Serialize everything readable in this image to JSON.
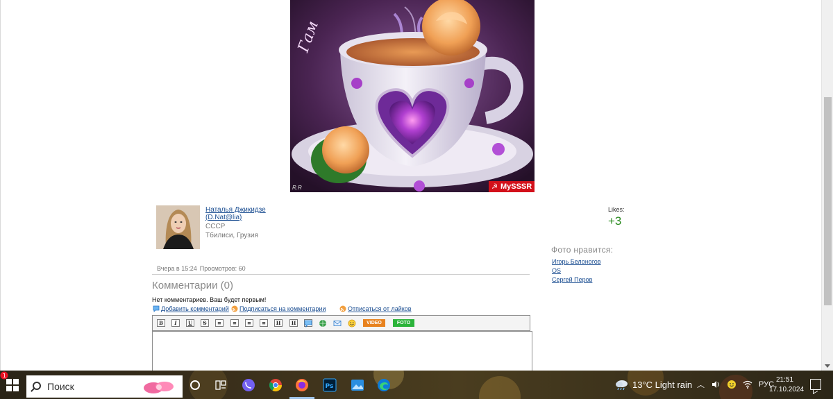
{
  "photo": {
    "badge_text": "MySSSR",
    "badge_star": "☭",
    "corner_mark": "R.R"
  },
  "author": {
    "name": "Наталья Джикидзе (D.Nat@lia)",
    "country": "СССР",
    "city": "Тбилиси, Грузия"
  },
  "likes": {
    "label": "Likes:",
    "count": "+3",
    "likers_title": "Фото нравится:",
    "likers": [
      "Игорь Белоногов",
      "OS",
      "Сергей Перов"
    ]
  },
  "meta": {
    "posted": "Вчера в 15:24",
    "views": "Просмотров: 60"
  },
  "comments": {
    "title": "Комментарии (0)",
    "empty_text": "Нет комментариев. Ваш будет первым!",
    "add_link": "Добавить комментарий",
    "subscribe_link": "Подписаться на комментарии",
    "unsubscribe_link": "Отписаться от лайков"
  },
  "editor": {
    "buttons": [
      "B",
      "I",
      "U",
      "S",
      "≡",
      "≡",
      "≡",
      "≡",
      "H",
      "H",
      "H"
    ],
    "video_label": "VIDEO",
    "foto_label": "FOTO"
  },
  "taskbar": {
    "search_placeholder": "Поиск",
    "weather": "13°C  Light rain",
    "weather_badge": "1",
    "language": "РУС",
    "time": "21:51",
    "date": "17.10.2024"
  },
  "colors": {
    "link": "#1a4d91",
    "likes_green": "#2a8a1f",
    "badge_red": "#d3101a",
    "video_orange": "#e8821e",
    "foto_green": "#2bb33a"
  }
}
